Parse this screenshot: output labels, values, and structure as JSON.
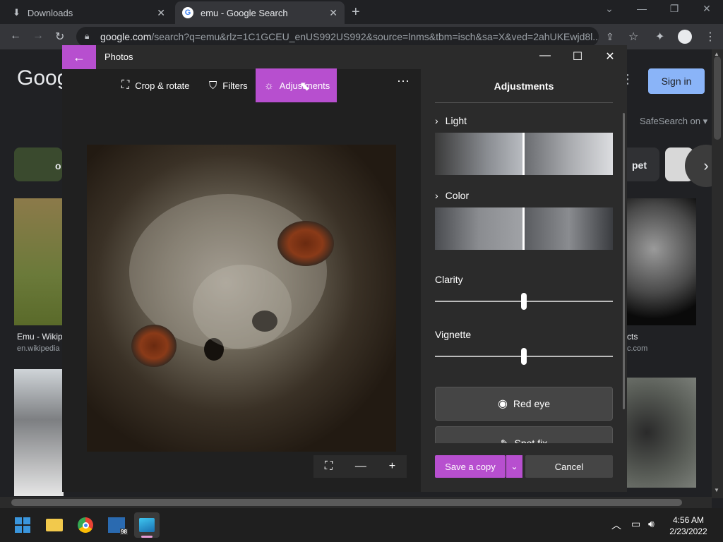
{
  "browser": {
    "tabs": [
      {
        "label": "Downloads",
        "icon": "download-icon"
      },
      {
        "label": "emu - Google Search",
        "icon": "google-icon"
      }
    ],
    "url_host": "google.com",
    "url_rest": "/search?q=emu&rlz=1C1GCEU_enUS992US992&source=lnms&tbm=isch&sa=X&ved=2ahUKEwjd8l..."
  },
  "google_page": {
    "logo_partial": "Goog",
    "sign_in": "Sign in",
    "safesearch": "SafeSearch on",
    "chip_pet": "pet",
    "chip_left": "o",
    "result1_title": "Emu - Wikip",
    "result1_source": "en.wikipedia",
    "result2_title": "cts",
    "result2_source": "c.com"
  },
  "photos": {
    "app_title": "Photos",
    "tools": {
      "crop": "Crop & rotate",
      "filters": "Filters",
      "adjustments": "Adjustments"
    },
    "panel_title": "Adjustments",
    "sections": {
      "light": "Light",
      "color": "Color"
    },
    "sliders": [
      {
        "label": "Clarity",
        "value": 0.5
      },
      {
        "label": "Vignette",
        "value": 0.5
      }
    ],
    "red_eye": "Red eye",
    "spot_fix": "Spot fix",
    "save_copy": "Save a copy",
    "cancel": "Cancel"
  },
  "taskbar": {
    "time": "4:56 AM",
    "date": "2/23/2022",
    "badge": "98"
  },
  "colors": {
    "accent": "#b74fcf"
  }
}
